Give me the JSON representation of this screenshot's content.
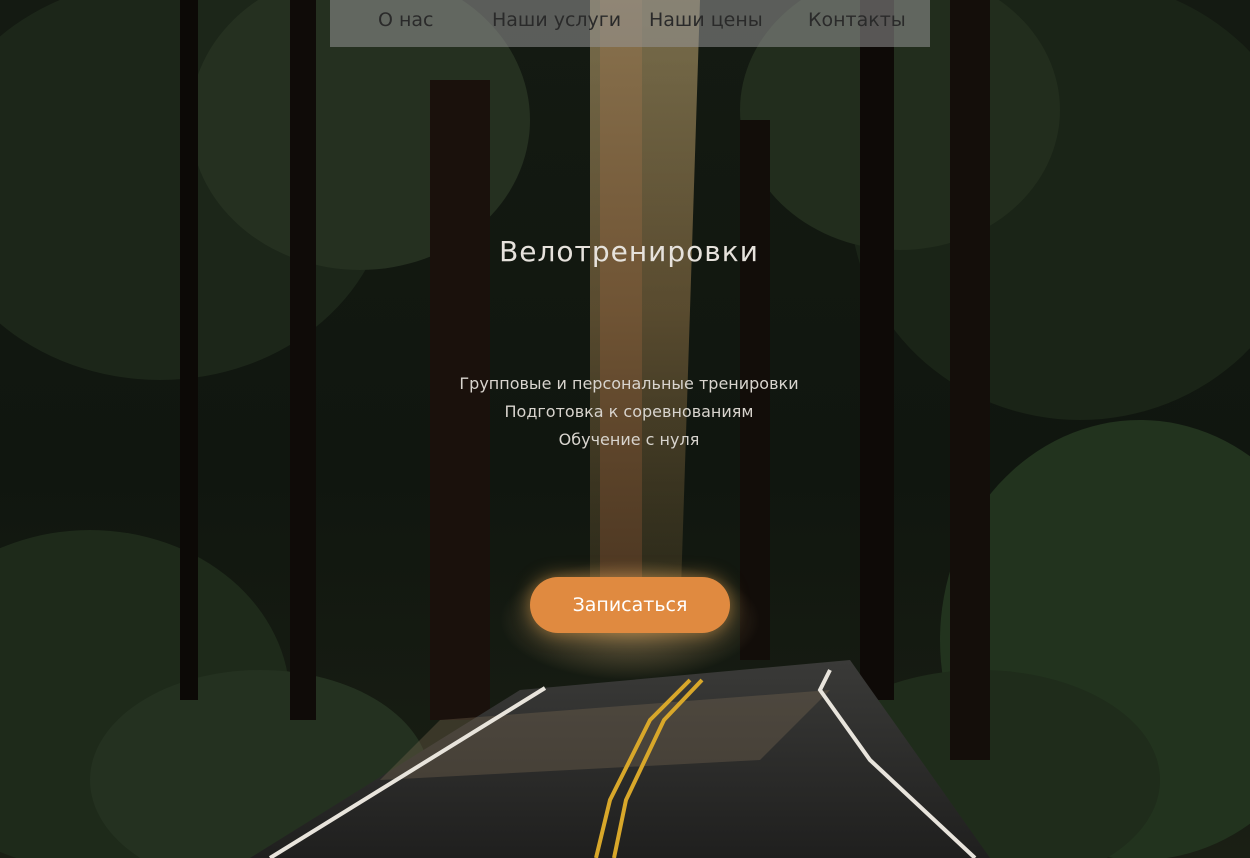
{
  "nav": {
    "items": [
      {
        "label": "О нас"
      },
      {
        "label": "Наши услуги"
      },
      {
        "label": "Наши цены"
      },
      {
        "label": "Контакты"
      }
    ]
  },
  "hero": {
    "title": "Велотренировки",
    "features": [
      "Групповые и персональные тренировки",
      "Подготовка к соревнованиям",
      "Обучение с нуля"
    ],
    "cta_label": "Записаться"
  },
  "colors": {
    "cta": "#e08a40",
    "nav_bg": "#969696",
    "text": "#e6e2dc"
  }
}
